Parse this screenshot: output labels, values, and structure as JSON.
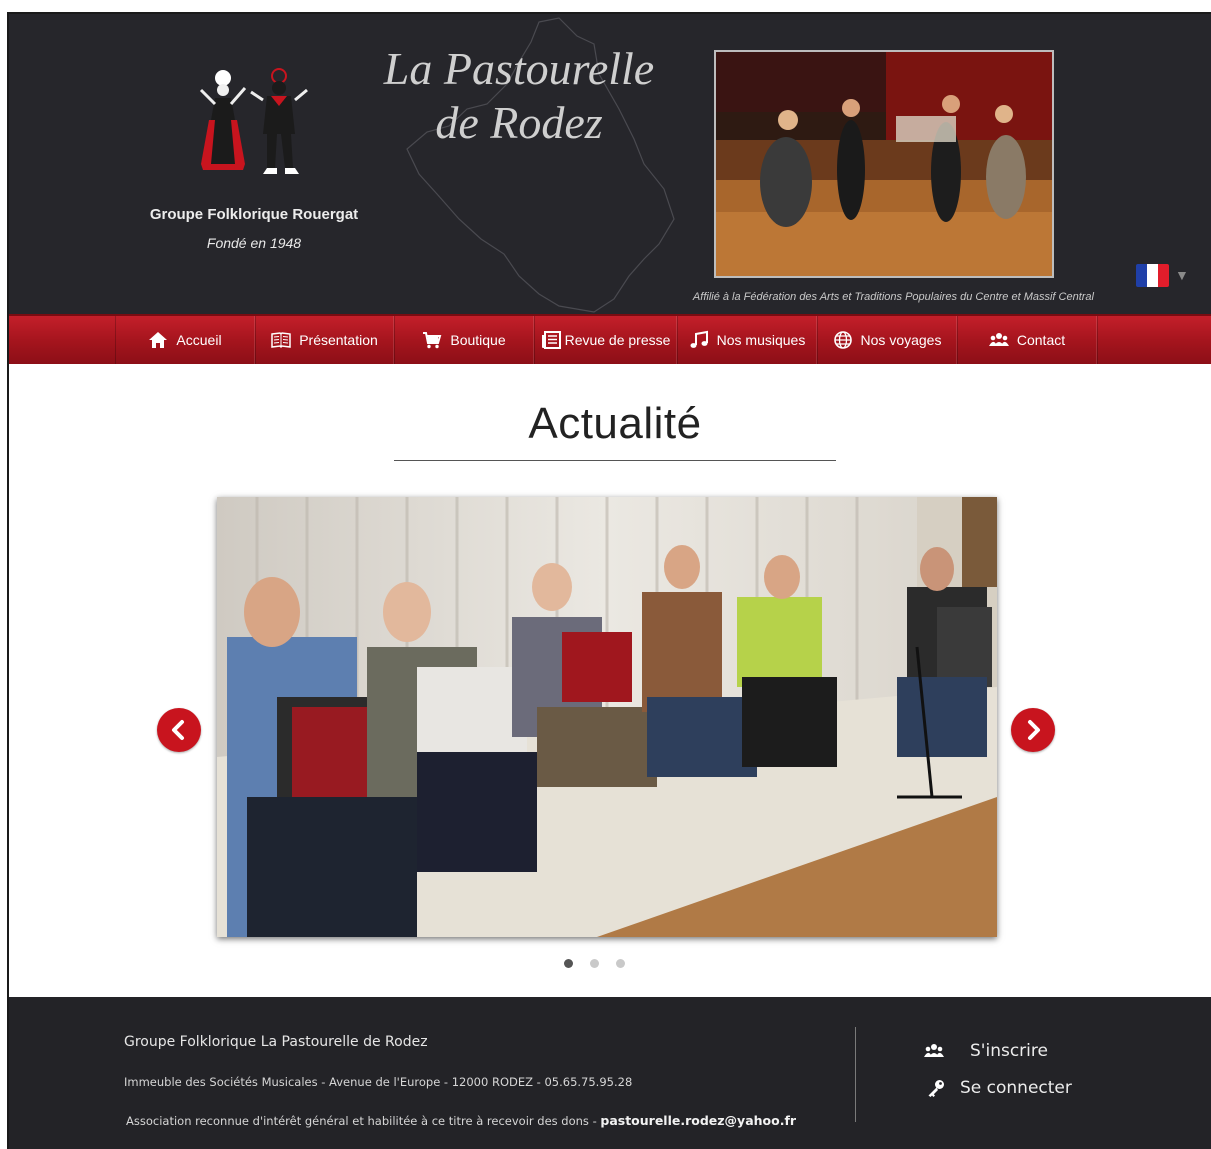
{
  "header": {
    "site_title_line1": "La Pastourelle",
    "site_title_line2": "de Rodez",
    "group_name": "Groupe Folklorique Rouergat",
    "founded": "Fondé en 1948",
    "affiliation": "Affilié à la Fédération des Arts et Traditions Populaires du Centre et Massif Central",
    "language_flag": "france-flag-icon",
    "flag_colors": [
      "#1f3fa8",
      "#ffffff",
      "#e11d2b"
    ]
  },
  "nav": {
    "items": [
      {
        "label": "Accueil",
        "icon": "home-icon"
      },
      {
        "label": "Présentation",
        "icon": "book-icon"
      },
      {
        "label": "Boutique",
        "icon": "cart-icon"
      },
      {
        "label": "Revue de presse",
        "icon": "newspaper-icon"
      },
      {
        "label": "Nos musiques",
        "icon": "music-note-icon"
      },
      {
        "label": "Nos voyages",
        "icon": "globe-icon"
      },
      {
        "label": "Contact",
        "icon": "users-icon"
      }
    ]
  },
  "main": {
    "section_title": "Actualité",
    "carousel": {
      "slide_count": 3,
      "active_index": 0,
      "prev_icon": "chevron-left-icon",
      "next_icon": "chevron-right-icon"
    }
  },
  "footer": {
    "org_name": "Groupe Folklorique La Pastourelle de Rodez",
    "address": "Immeuble des Sociétés Musicales - Avenue de l'Europe - 12000 RODEZ - 05.65.75.95.28",
    "association_text": "Association reconnue d'intérêt général et habilitée à ce titre à recevoir des dons - ",
    "email": "pastourelle.rodez@yahoo.fr",
    "signup_label": "S'inscrire",
    "login_label": "Se connecter"
  },
  "colors": {
    "header_bg": "#26262b",
    "nav_red": "#b0161f",
    "accent_red": "#c8141e",
    "footer_bg": "#232327"
  }
}
